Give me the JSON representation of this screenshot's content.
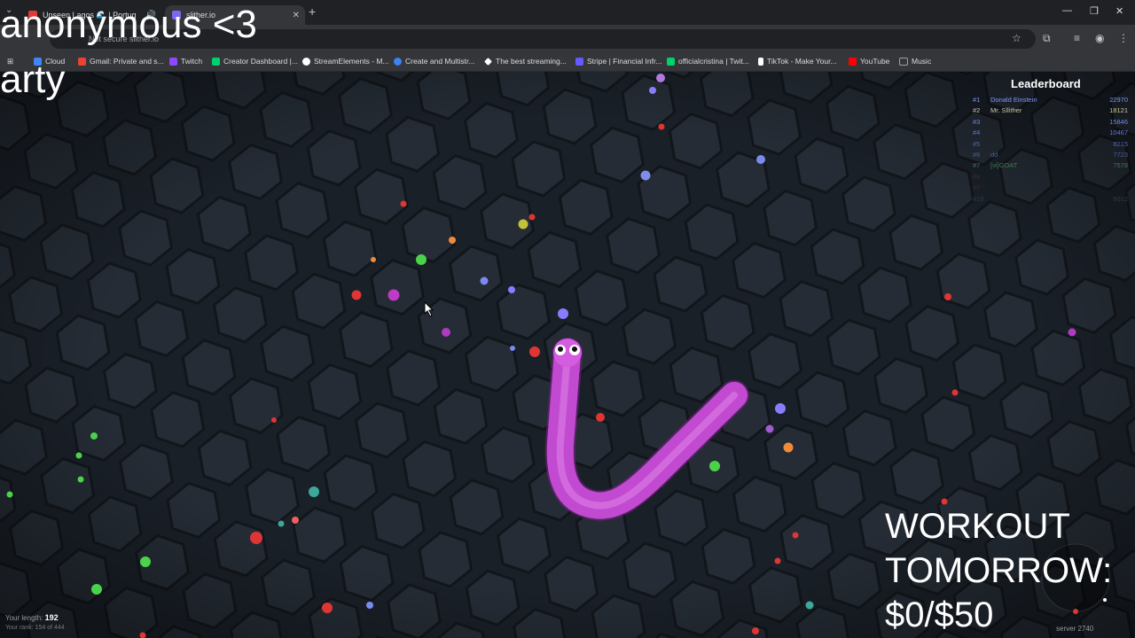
{
  "browser": {
    "tabs": [
      {
        "title": "Unseen Lagos 🌊 | Portug",
        "active": false,
        "favicon_color": "#e53935"
      },
      {
        "title": "slither.io",
        "active": true,
        "favicon_color": "#7b68ee"
      }
    ],
    "url": "Not secure  slither.io",
    "bookmarks": [
      {
        "label": "Cloud",
        "icon_color": "#4285f4"
      },
      {
        "label": "Gmail: Private and s...",
        "icon_color": "#ea4335"
      },
      {
        "label": "Twitch",
        "icon_color": "#9146ff"
      },
      {
        "label": "Creator Dashboard |...",
        "icon_color": "#00d26a"
      },
      {
        "label": "StreamElements - M...",
        "icon_color": "#ffffff"
      },
      {
        "label": "Create and Multistr...",
        "icon_color": "#3b82f6"
      },
      {
        "label": "The best streaming...",
        "icon_color": "#ffffff"
      },
      {
        "label": "Stripe | Financial Infr...",
        "icon_color": "#635bff"
      },
      {
        "label": "officialcristina | Twit...",
        "icon_color": "#00d26a"
      },
      {
        "label": "TikTok - Make Your...",
        "icon_color": "#ffffff"
      },
      {
        "label": "YouTube",
        "icon_color": "#ff0000"
      },
      {
        "label": "Music",
        "icon_color": "#9aa0a6"
      }
    ]
  },
  "overlay": {
    "line1": "anonymous <3",
    "line2": "arty",
    "goal_line1": "WORKOUT",
    "goal_line2": "TOMORROW:",
    "goal_line3": "$0/$50"
  },
  "leaderboard": {
    "title": "Leaderboard",
    "rows": [
      {
        "rank": "#1",
        "name": "Donald Einstein",
        "score": "22970",
        "color": "#7d97ff"
      },
      {
        "rank": "#2",
        "name": "Mr. Sllither",
        "score": "18121",
        "color": "#c8c8a0"
      },
      {
        "rank": "#3",
        "name": "",
        "score": "15846",
        "color": "#6d86e6"
      },
      {
        "rank": "#4",
        "name": "",
        "score": "10467",
        "color": "#5a78d8"
      },
      {
        "rank": "#5",
        "name": "",
        "score": "8215",
        "color": "#4d64b8"
      },
      {
        "rank": "#6",
        "name": "dd",
        "score": "7723",
        "color": "#46609c"
      },
      {
        "rank": "#7",
        "name": "[vi]GOAT",
        "score": "7578",
        "color": "#3f7a50"
      },
      {
        "rank": "#8",
        "name": "",
        "score": "",
        "color": "#4a2438"
      },
      {
        "rank": "#9",
        "name": "",
        "score": "",
        "color": "#3a2530"
      },
      {
        "rank": "#10",
        "name": "",
        "score": "5012",
        "color": "#2e3a4a"
      }
    ]
  },
  "stats": {
    "length_label": "Your length:",
    "length_value": "192",
    "rank_text": "Your rank: 154 of 444"
  },
  "server": "server 2740",
  "colors": {
    "snake": "#d35ce0",
    "snake_shadow": "#8a2a96",
    "hex_fill": "#232a33",
    "background": "#171c22"
  }
}
